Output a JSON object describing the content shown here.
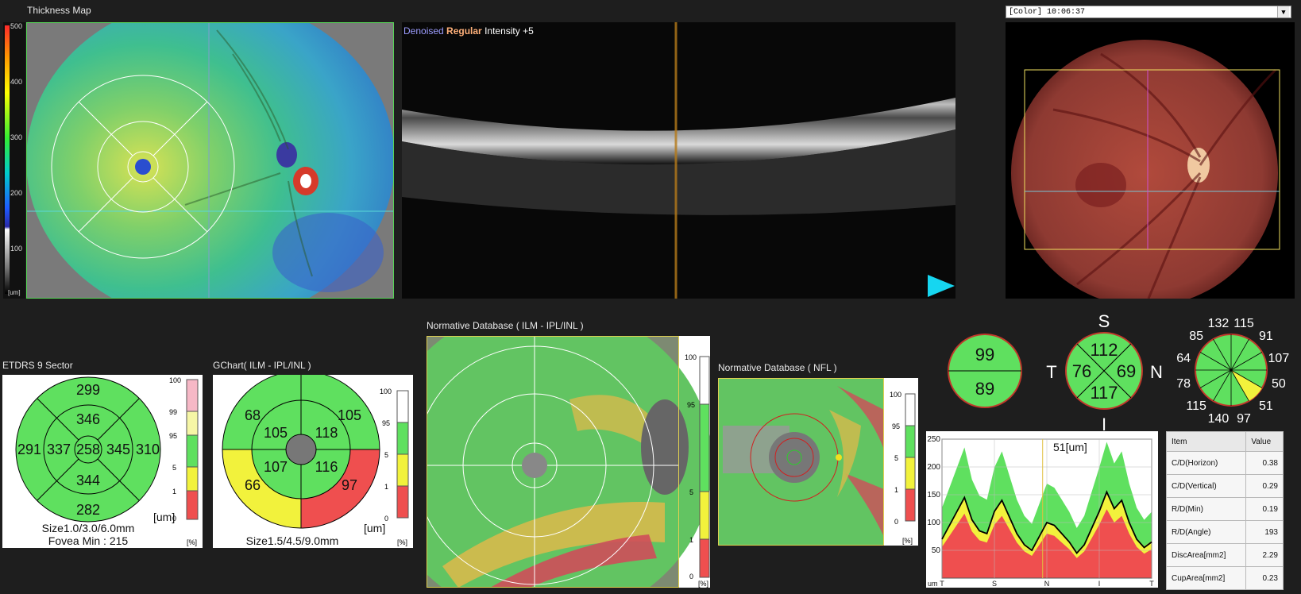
{
  "thickness": {
    "title": "Thickness Map",
    "scale_labels": [
      "500",
      "400",
      "300",
      "200",
      "100"
    ],
    "unit": "[um]"
  },
  "bscan": {
    "denoised": "Denoised",
    "regular": "Regular",
    "intensity": "Intensity +5"
  },
  "fundus": {
    "dropdown_value": "[Color]  10:06:37"
  },
  "etdrs": {
    "title": "ETDRS 9 Sector",
    "outer_top": "299",
    "outer_left": "291",
    "outer_right": "310",
    "outer_bottom": "282",
    "inner_top": "346",
    "inner_left": "337",
    "inner_right": "345",
    "inner_bottom": "344",
    "center": "258",
    "unit": "[um]",
    "size": "Size1.0/3.0/6.0mm",
    "fovea": "Fovea Min : 215"
  },
  "pct_scale_a": {
    "labels": [
      "100",
      "99",
      "95",
      "5",
      "1",
      "0"
    ],
    "unit": "[%]"
  },
  "gchart": {
    "title": "GChart( ILM - IPL/INL )",
    "outer_tl": "68",
    "outer_tr": "105",
    "outer_bl": "66",
    "outer_br": "97",
    "inner_tl": "105",
    "inner_tr": "118",
    "inner_bl": "107",
    "inner_br": "116",
    "unit": "[um]",
    "size": "Size1.5/4.5/9.0mm"
  },
  "pct_scale_b": {
    "labels": [
      "100",
      "95",
      "5",
      "1",
      "0"
    ],
    "unit": "[%]"
  },
  "normdb_gcl": {
    "title": "Normative Database ( ILM - IPL/INL )",
    "scale_labels": [
      "100",
      "95",
      "5",
      "1",
      "0"
    ],
    "unit": "[%]"
  },
  "normdb_nfl": {
    "title": "Normative Database ( NFL )",
    "scale_labels": [
      "100",
      "95",
      "5",
      "1",
      "0"
    ],
    "unit": "[%]"
  },
  "halves": {
    "top": "99",
    "bottom": "89"
  },
  "quadrants": {
    "S": "S",
    "T": "T",
    "N": "N",
    "I": "I",
    "sup": "112",
    "tem": "76",
    "nas": "69",
    "inf": "117"
  },
  "clock": {
    "values": [
      "115",
      "91",
      "107",
      "50",
      "51",
      "97",
      "140",
      "115",
      "78",
      "64",
      "85",
      "132"
    ]
  },
  "tsnit": {
    "readout": "51[um]",
    "y_ticks": [
      "250",
      "200",
      "150",
      "100",
      "50"
    ],
    "x_ticks": [
      "T",
      "S",
      "N",
      "I",
      "T"
    ],
    "y_unit": "um",
    "chart_data": {
      "type": "line",
      "x_categories": [
        "T",
        "S",
        "N",
        "I",
        "T"
      ],
      "ylim": [
        0,
        250
      ],
      "series": [
        {
          "values": [
            70,
            95,
            120,
            145,
            105,
            85,
            80,
            120,
            140,
            110,
            80,
            60,
            50,
            75,
            100,
            95,
            80,
            65,
            45,
            60,
            90,
            120,
            155,
            125,
            140,
            100,
            70,
            55,
            65
          ]
        }
      ]
    }
  },
  "table": {
    "headers": [
      "Item",
      "Value"
    ],
    "rows": [
      [
        "C/D(Horizon)",
        "0.38"
      ],
      [
        "C/D(Vertical)",
        "0.29"
      ],
      [
        "R/D(Min)",
        "0.19"
      ],
      [
        "R/D(Angle)",
        "193"
      ],
      [
        "DiscArea[mm2]",
        "2.29"
      ],
      [
        "CupArea[mm2]",
        "0.23"
      ]
    ]
  },
  "colors": {
    "green": "#5fe05f",
    "yellow": "#f2f23c",
    "red": "#ef4f4f",
    "pink": "#f6b8c6",
    "lightyellow": "#f6f6a6"
  }
}
